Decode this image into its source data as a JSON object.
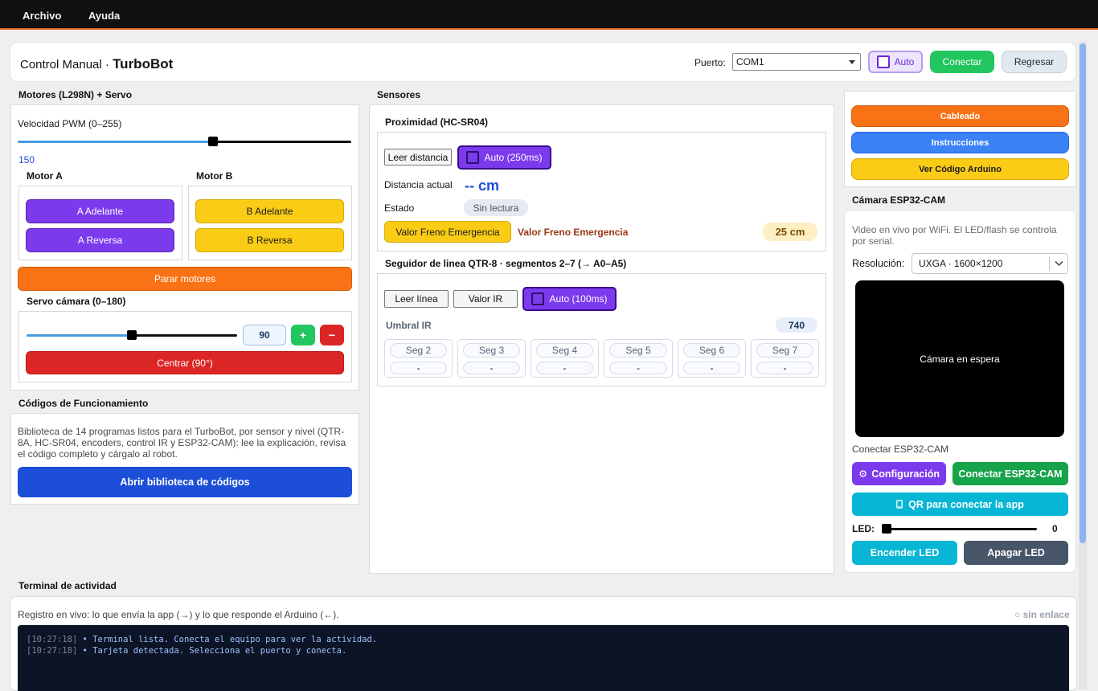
{
  "menu": [
    "Archivo",
    "Ayuda"
  ],
  "header": {
    "title_prefix": "Control Manual · ",
    "title_bold": "TurboBot",
    "port_label": "Puerto:",
    "port_value": "COM1",
    "auto_label": "Auto",
    "connect_label": "Conectar",
    "back_label": "Regresar"
  },
  "motors": {
    "title": "Motores (L298N) + Servo",
    "pwm_label": "Velocidad PWM (0–255)",
    "pwm_value": "150",
    "pwm_fraction": 0.588,
    "motor_a": {
      "title": "Motor A",
      "forward": "A Adelante",
      "reverse": "A Reversa"
    },
    "motor_b": {
      "title": "Motor B",
      "forward": "B Adelante",
      "reverse": "B Reversa"
    },
    "stop_label": "Parar motores",
    "servo_title": "Servo cámara (0–180)",
    "servo_value": "90",
    "servo_fraction": 0.5,
    "plus": "+",
    "minus": "−",
    "center_label": "Centrar (90°)"
  },
  "codes": {
    "title": "Códigos de Funcionamiento",
    "description": "Biblioteca de 14 programas listos para el TurboBot, por sensor y nivel (QTR-8A, HC-SR04, encoders, control IR y ESP32-CAM): lee la explicación, revisa el código completo y cárgalo al robot.",
    "open_label": "Abrir biblioteca de códigos"
  },
  "sensors": {
    "title": "Sensores",
    "proximity": {
      "title": "Proximidad (HC-SR04)",
      "read_label": "Leer distancia",
      "auto_label": "Auto (250ms)",
      "distance_label": "Distancia actual",
      "distance_value": "-- cm",
      "state_label": "Estado",
      "state_value": "Sin lectura",
      "brake_button": "Valor Freno Emergencia",
      "brake_text": "Valor Freno Emergencia",
      "brake_value": "25 cm"
    },
    "line": {
      "title": "Seguidor de linea QTR-8 · segmentos 2–7 (→ A0–A5)",
      "read_label": "Leer línea",
      "ir_label": "Valor IR",
      "auto_label": "Auto (100ms)",
      "threshold_label": "Umbral IR",
      "threshold_value": "740",
      "segments": [
        {
          "name": "Seg 2",
          "value": "-"
        },
        {
          "name": "Seg 3",
          "value": "-"
        },
        {
          "name": "Seg 4",
          "value": "-"
        },
        {
          "name": "Seg 5",
          "value": "-"
        },
        {
          "name": "Seg 6",
          "value": "-"
        },
        {
          "name": "Seg 7",
          "value": "-"
        }
      ]
    }
  },
  "right": {
    "wiring": "Cableado",
    "instructions": "Instrucciones",
    "arduino_code": "Ver Código Arduino",
    "cam_title": "Cámara ESP32-CAM",
    "cam_desc": "Video en vivo por WiFi. El LED/flash se controla por serial.",
    "resolution_label": "Resolución:",
    "resolution_value": "UXGA · 1600×1200",
    "cam_idle": "Cámara en espera",
    "connect_cam_label": "Conectar ESP32-CAM",
    "config_label": "Configuración",
    "connect_cam_button": "Conectar ESP32-CAM",
    "qr_label": "QR para conectar la app",
    "led_label": "LED:",
    "led_value": "0",
    "led_fraction": 0,
    "led_on": "Encender LED",
    "led_off": "Apagar LED"
  },
  "terminal": {
    "title": "Terminal de actividad",
    "description": "Registro en vivo: lo que envía la app (→) y lo que responde el Arduino (←).",
    "status": "○ sin enlace",
    "lines": [
      {
        "time": "[10:27:18]",
        "text": "• Terminal lista. Conecta el equipo para ver la actividad."
      },
      {
        "time": "[10:27:18]",
        "text": "• Tarjeta detectada. Selecciona el puerto y conecta."
      }
    ]
  },
  "colors": {
    "purple": "#7c3aed",
    "yellow": "#facc15",
    "orange": "#f97316",
    "red": "#dc2626",
    "green": "#22c55e",
    "blue": "#1d4ed8",
    "cyan": "#06b6d4",
    "slate": "#475569",
    "accent_line": "#e0631c"
  }
}
